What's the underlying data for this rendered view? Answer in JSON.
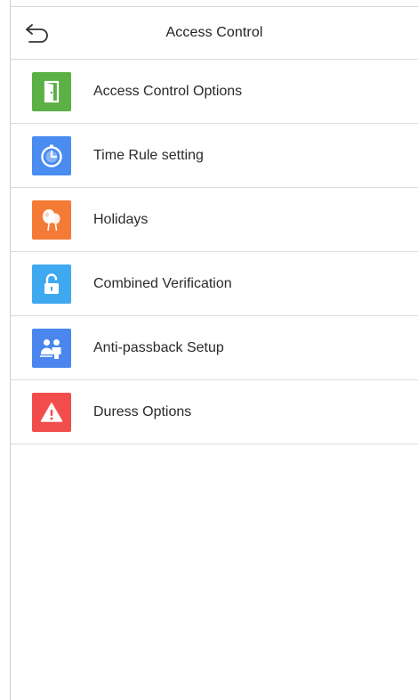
{
  "header": {
    "title": "Access Control",
    "back_icon": "back-arrow-icon"
  },
  "menu": {
    "items": [
      {
        "label": "Access Control Options",
        "icon": "door-icon",
        "color": "#5bb046"
      },
      {
        "label": "Time Rule setting",
        "icon": "clock-icon",
        "color": "#4a8cf0"
      },
      {
        "label": "Holidays",
        "icon": "balloons-icon",
        "color": "#f47b35"
      },
      {
        "label": "Combined Verification",
        "icon": "unlock-icon",
        "color": "#3fa9f0"
      },
      {
        "label": "Anti-passback Setup",
        "icon": "people-icon",
        "color": "#4a86ee"
      },
      {
        "label": "Duress Options",
        "icon": "warning-icon",
        "color": "#f24d4d"
      }
    ]
  }
}
